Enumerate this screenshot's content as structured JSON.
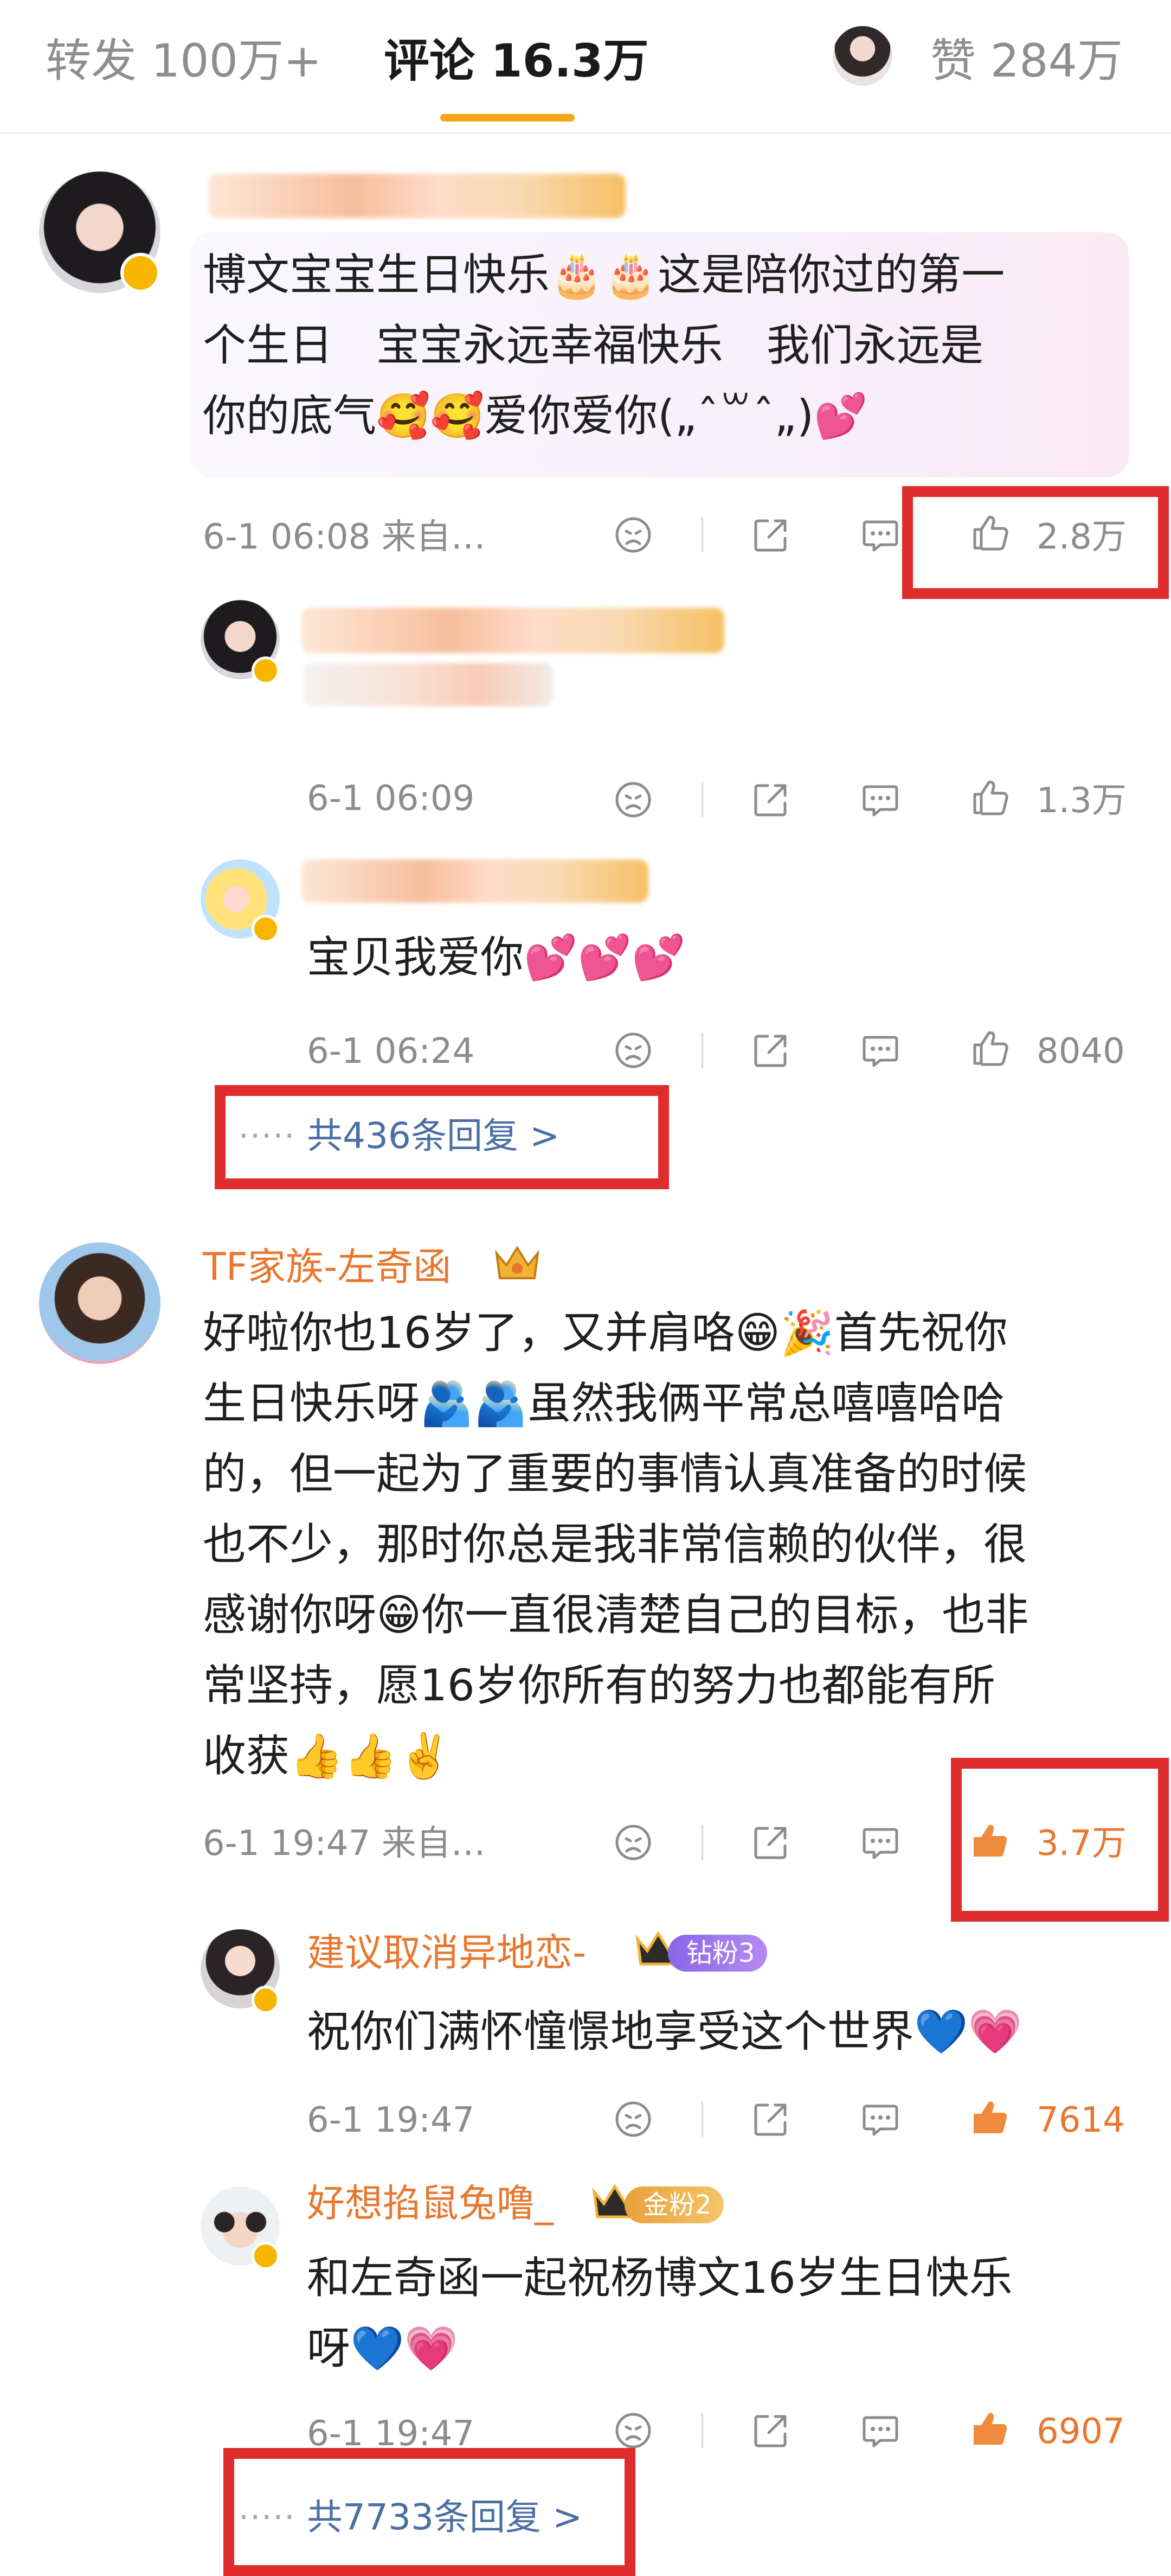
{
  "tabs": {
    "repost": "转发 100万+",
    "comments": "评论 16.3万",
    "likes": "赞 284万"
  },
  "comments": [
    {
      "text_lines": [
        "博文宝宝生日快乐🎂🎂这是陪你过的第一",
        "个生日　宝宝永远幸福快乐　我们永远是",
        "你的底气🥰🥰爱你爱你(„ˆ꒳ˆ„)💕"
      ],
      "time": "6-1 06:08 来自…",
      "likes": "2.8万",
      "replies": [
        {
          "time": "6-1 06:09",
          "likes": "1.3万"
        },
        {
          "text": "宝贝我爱你💕💕💕",
          "time": "6-1 06:24",
          "likes": "8040"
        }
      ],
      "more_replies": "共436条回复 >"
    },
    {
      "username": "TF家族-左奇函",
      "text_lines": [
        "好啦你也16岁了，又并肩咯😁🎉首先祝你",
        "生日快乐呀🫂🫂虽然我俩平常总嘻嘻哈哈",
        "的，但一起为了重要的事情认真准备的时候",
        "也不少，那时你总是我非常信赖的伙伴，很",
        "感谢你呀😁你一直很清楚自己的目标，也非",
        "常坚持，愿16岁你所有的努力也都能有所",
        "收获👍👍✌️"
      ],
      "time": "6-1 19:47 来自…",
      "likes": "3.7万",
      "replies": [
        {
          "username": "建议取消异地恋-",
          "badge": "钻粉3",
          "text": "祝你们满怀憧憬地享受这个世界💙💗",
          "time": "6-1 19:47",
          "likes": "7614"
        },
        {
          "username": "好想掐鼠兔噜_",
          "badge": "金粉2",
          "text_lines": [
            "和左奇函一起祝杨博文16岁生日快乐",
            "呀💙💗"
          ],
          "time": "6-1 19:47",
          "likes": "6907"
        }
      ],
      "more_replies": "共7733条回复 >"
    }
  ],
  "dots": "·····",
  "icons": [
    "frown-icon",
    "share-icon",
    "comment-icon",
    "thumbs-up-icon"
  ],
  "colors": {
    "accent": "#f7a618",
    "username": "#e8772e",
    "link": "#4a6fa5",
    "highlight_box": "#e02c2c"
  }
}
